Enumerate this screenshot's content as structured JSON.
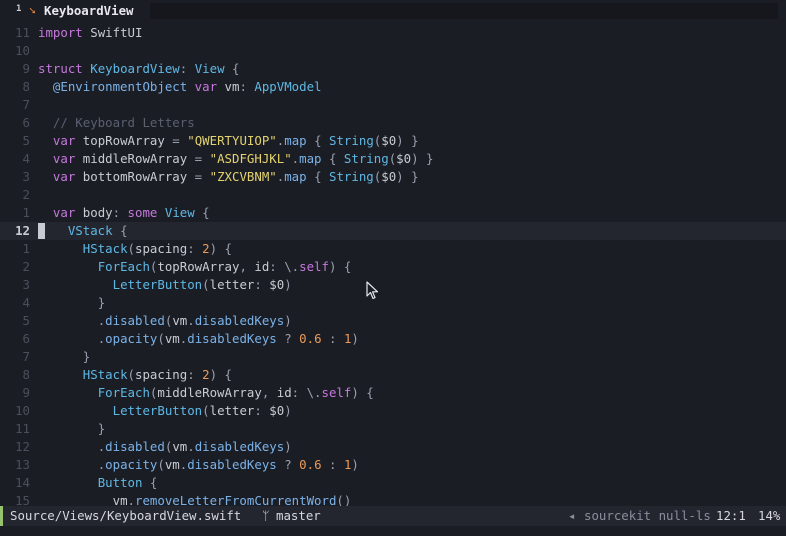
{
  "tab": {
    "number": "1",
    "icon": "swift-icon",
    "title": "KeyboardView"
  },
  "lines": [
    {
      "ln": "11",
      "tokens": [
        [
          "kw",
          "import"
        ],
        [
          "pw",
          " "
        ],
        [
          "id",
          "SwiftUI"
        ]
      ]
    },
    {
      "ln": "10",
      "tokens": []
    },
    {
      "ln": "9",
      "tokens": [
        [
          "kw",
          "struct"
        ],
        [
          "pw",
          " "
        ],
        [
          "ty",
          "KeyboardView"
        ],
        [
          "pn",
          ": "
        ],
        [
          "ty",
          "View"
        ],
        [
          "pn",
          " {"
        ]
      ]
    },
    {
      "ln": "8",
      "tokens": [
        [
          "pw",
          "  "
        ],
        [
          "fn",
          "@EnvironmentObject"
        ],
        [
          "pw",
          " "
        ],
        [
          "kw",
          "var"
        ],
        [
          "pw",
          " "
        ],
        [
          "id",
          "vm"
        ],
        [
          "pn",
          ": "
        ],
        [
          "ty",
          "AppVModel"
        ]
      ]
    },
    {
      "ln": "7",
      "tokens": []
    },
    {
      "ln": "6",
      "tokens": [
        [
          "pw",
          "  "
        ],
        [
          "cm",
          "// Keyboard Letters"
        ]
      ]
    },
    {
      "ln": "5",
      "tokens": [
        [
          "pw",
          "  "
        ],
        [
          "kw",
          "var"
        ],
        [
          "pw",
          " "
        ],
        [
          "id",
          "topRowArray"
        ],
        [
          "pn",
          " = "
        ],
        [
          "str",
          "\"QWERTYUIOP\""
        ],
        [
          "pn",
          "."
        ],
        [
          "fn",
          "map"
        ],
        [
          "pn",
          " { "
        ],
        [
          "ty",
          "String"
        ],
        [
          "pn",
          "("
        ],
        [
          "id",
          "$0"
        ],
        [
          "pn",
          ") }"
        ]
      ]
    },
    {
      "ln": "4",
      "tokens": [
        [
          "pw",
          "  "
        ],
        [
          "kw",
          "var"
        ],
        [
          "pw",
          " "
        ],
        [
          "id",
          "middleRowArray"
        ],
        [
          "pn",
          " = "
        ],
        [
          "str",
          "\"ASDFGHJKL\""
        ],
        [
          "pn",
          "."
        ],
        [
          "fn",
          "map"
        ],
        [
          "pn",
          " { "
        ],
        [
          "ty",
          "String"
        ],
        [
          "pn",
          "("
        ],
        [
          "id",
          "$0"
        ],
        [
          "pn",
          ") }"
        ]
      ]
    },
    {
      "ln": "3",
      "tokens": [
        [
          "pw",
          "  "
        ],
        [
          "kw",
          "var"
        ],
        [
          "pw",
          " "
        ],
        [
          "id",
          "bottomRowArray"
        ],
        [
          "pn",
          " = "
        ],
        [
          "str",
          "\"ZXCVBNM\""
        ],
        [
          "pn",
          "."
        ],
        [
          "fn",
          "map"
        ],
        [
          "pn",
          " { "
        ],
        [
          "ty",
          "String"
        ],
        [
          "pn",
          "("
        ],
        [
          "id",
          "$0"
        ],
        [
          "pn",
          ") }"
        ]
      ]
    },
    {
      "ln": "2",
      "tokens": []
    },
    {
      "ln": "1",
      "tokens": [
        [
          "pw",
          "  "
        ],
        [
          "kw",
          "var"
        ],
        [
          "pw",
          " "
        ],
        [
          "id",
          "body"
        ],
        [
          "pn",
          ": "
        ],
        [
          "kw",
          "some"
        ],
        [
          "pw",
          " "
        ],
        [
          "ty",
          "View"
        ],
        [
          "pn",
          " {"
        ]
      ]
    },
    {
      "ln": "12",
      "current": true,
      "tokens": [
        [
          "pw",
          "    "
        ],
        [
          "ty",
          "VStack"
        ],
        [
          "pn",
          " {"
        ]
      ]
    },
    {
      "ln": "1",
      "tokens": [
        [
          "pw",
          "      "
        ],
        [
          "ty",
          "HStack"
        ],
        [
          "pn",
          "("
        ],
        [
          "id",
          "spacing"
        ],
        [
          "pn",
          ": "
        ],
        [
          "num",
          "2"
        ],
        [
          "pn",
          ") {"
        ]
      ]
    },
    {
      "ln": "2",
      "tokens": [
        [
          "pw",
          "        "
        ],
        [
          "ty",
          "ForEach"
        ],
        [
          "pn",
          "("
        ],
        [
          "id",
          "topRowArray"
        ],
        [
          "pn",
          ", "
        ],
        [
          "id",
          "id"
        ],
        [
          "pn",
          ": \\."
        ],
        [
          "kw",
          "self"
        ],
        [
          "pn",
          ") {"
        ]
      ]
    },
    {
      "ln": "3",
      "tokens": [
        [
          "pw",
          "          "
        ],
        [
          "ty",
          "LetterButton"
        ],
        [
          "pn",
          "("
        ],
        [
          "id",
          "letter"
        ],
        [
          "pn",
          ": "
        ],
        [
          "id",
          "$0"
        ],
        [
          "pn",
          ")"
        ]
      ]
    },
    {
      "ln": "4",
      "tokens": [
        [
          "pw",
          "        "
        ],
        [
          "pn",
          "}"
        ]
      ]
    },
    {
      "ln": "5",
      "tokens": [
        [
          "pw",
          "        "
        ],
        [
          "pn",
          "."
        ],
        [
          "fn",
          "disabled"
        ],
        [
          "pn",
          "("
        ],
        [
          "id",
          "vm"
        ],
        [
          "pn",
          "."
        ],
        [
          "fn",
          "disabledKeys"
        ],
        [
          "pn",
          ")"
        ]
      ]
    },
    {
      "ln": "6",
      "tokens": [
        [
          "pw",
          "        "
        ],
        [
          "pn",
          "."
        ],
        [
          "fn",
          "opacity"
        ],
        [
          "pn",
          "("
        ],
        [
          "id",
          "vm"
        ],
        [
          "pn",
          "."
        ],
        [
          "fn",
          "disabledKeys"
        ],
        [
          "pn",
          " ? "
        ],
        [
          "num",
          "0.6"
        ],
        [
          "pn",
          " : "
        ],
        [
          "num",
          "1"
        ],
        [
          "pn",
          ")"
        ]
      ]
    },
    {
      "ln": "7",
      "tokens": [
        [
          "pw",
          "      "
        ],
        [
          "pn",
          "}"
        ]
      ]
    },
    {
      "ln": "8",
      "tokens": [
        [
          "pw",
          "      "
        ],
        [
          "ty",
          "HStack"
        ],
        [
          "pn",
          "("
        ],
        [
          "id",
          "spacing"
        ],
        [
          "pn",
          ": "
        ],
        [
          "num",
          "2"
        ],
        [
          "pn",
          ") {"
        ]
      ]
    },
    {
      "ln": "9",
      "tokens": [
        [
          "pw",
          "        "
        ],
        [
          "ty",
          "ForEach"
        ],
        [
          "pn",
          "("
        ],
        [
          "id",
          "middleRowArray"
        ],
        [
          "pn",
          ", "
        ],
        [
          "id",
          "id"
        ],
        [
          "pn",
          ": \\."
        ],
        [
          "kw",
          "self"
        ],
        [
          "pn",
          ") {"
        ]
      ]
    },
    {
      "ln": "10",
      "tokens": [
        [
          "pw",
          "          "
        ],
        [
          "ty",
          "LetterButton"
        ],
        [
          "pn",
          "("
        ],
        [
          "id",
          "letter"
        ],
        [
          "pn",
          ": "
        ],
        [
          "id",
          "$0"
        ],
        [
          "pn",
          ")"
        ]
      ]
    },
    {
      "ln": "11",
      "tokens": [
        [
          "pw",
          "        "
        ],
        [
          "pn",
          "}"
        ]
      ]
    },
    {
      "ln": "12",
      "tokens": [
        [
          "pw",
          "        "
        ],
        [
          "pn",
          "."
        ],
        [
          "fn",
          "disabled"
        ],
        [
          "pn",
          "("
        ],
        [
          "id",
          "vm"
        ],
        [
          "pn",
          "."
        ],
        [
          "fn",
          "disabledKeys"
        ],
        [
          "pn",
          ")"
        ]
      ]
    },
    {
      "ln": "13",
      "tokens": [
        [
          "pw",
          "        "
        ],
        [
          "pn",
          "."
        ],
        [
          "fn",
          "opacity"
        ],
        [
          "pn",
          "("
        ],
        [
          "id",
          "vm"
        ],
        [
          "pn",
          "."
        ],
        [
          "fn",
          "disabledKeys"
        ],
        [
          "pn",
          " ? "
        ],
        [
          "num",
          "0.6"
        ],
        [
          "pn",
          " : "
        ],
        [
          "num",
          "1"
        ],
        [
          "pn",
          ")"
        ]
      ]
    },
    {
      "ln": "14",
      "tokens": [
        [
          "pw",
          "        "
        ],
        [
          "ty",
          "Button"
        ],
        [
          "pn",
          " {"
        ]
      ]
    },
    {
      "ln": "15",
      "tokens": [
        [
          "pw",
          "          "
        ],
        [
          "id",
          "vm"
        ],
        [
          "pn",
          "."
        ],
        [
          "fn",
          "removeLetterFromCurrentWord"
        ],
        [
          "pn",
          "()"
        ]
      ]
    }
  ],
  "status": {
    "path": "Source/Views/KeyboardView.swift",
    "branch_icon": "git-branch-icon",
    "branch": "master",
    "lsp_icon": "lsp-icon",
    "lsp": "sourcekit null-ls",
    "position": "12:1",
    "percent": "14%"
  },
  "colors": {
    "background": "#1b1d25",
    "current_line": "#23262f",
    "keyword": "#c678dd",
    "type": "#5fb8e4",
    "string": "#e3d26f",
    "number": "#ea9a5a",
    "comment": "#5a6070",
    "function": "#7ab2e8",
    "mode_indicator": "#98c36d",
    "tab_icon": "#e0823d"
  }
}
